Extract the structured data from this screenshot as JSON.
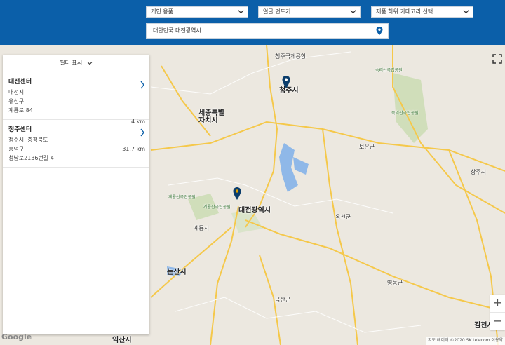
{
  "header": {
    "selects": [
      {
        "value": "개인 용품"
      },
      {
        "value": "얼굴 면도기"
      },
      {
        "value": "제품 하위 카테고리 선택"
      }
    ],
    "location": "대한민국 대전광역시"
  },
  "panel": {
    "filter_label": "필터 표시",
    "items": [
      {
        "name": "대전센터",
        "line1": "대전시",
        "line2": "유성구",
        "line3": "계룡로 84",
        "line4": "",
        "distance": "4 km"
      },
      {
        "name": "청주센터",
        "line1": "청주시, 충청북도",
        "line2": "흥덕구",
        "line3": "청남로2136번길 4",
        "line4": "",
        "distance": "31.7 km"
      }
    ]
  },
  "map": {
    "labels": {
      "cheongju_park": "청주국제공항",
      "cheongju": "청주시",
      "songnisan": "속리산국립공원",
      "songnisan2": "속리산국립공원",
      "sejong": "세종특별자치시",
      "boeun": "보은군",
      "sangju": "상주시",
      "gyeryongsan": "계룡산국립공원",
      "gyeryongsan2": "계룡산국립공원",
      "daejeon": "대전광역시",
      "okcheon": "옥천군",
      "gyeryong": "계룡시",
      "nonsan": "논산시",
      "geumsan": "금산군",
      "yeongdong": "영동군",
      "iksan": "익산시",
      "gimcheon": "김천시"
    },
    "zoom_in": "+",
    "zoom_out": "−",
    "google": "Google",
    "attribution": "지도 데이터 ©2020 SK telecom   이용약"
  },
  "colors": {
    "header_bg": "#0b5fa9",
    "marker_blue": "#0b3d6b",
    "marker_gold": "#e0a100"
  }
}
